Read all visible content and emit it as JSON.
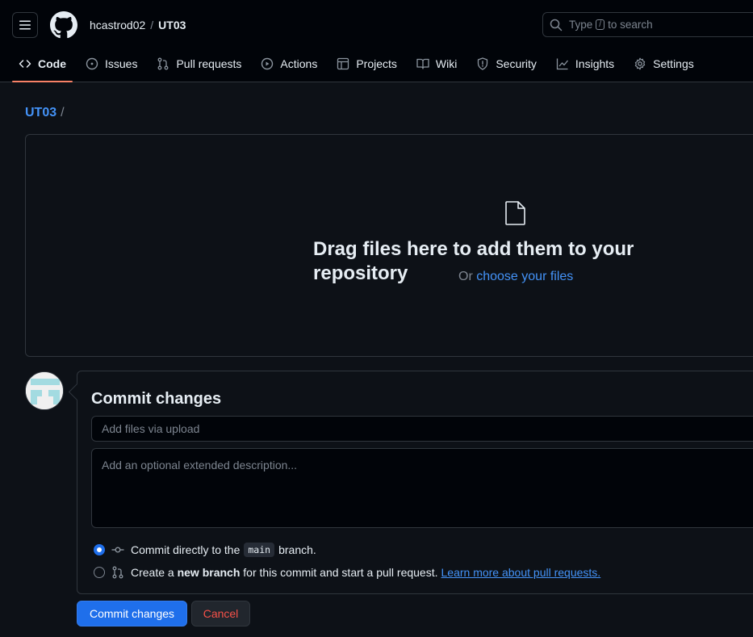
{
  "header": {
    "owner": "hcastrod02",
    "separator": "/",
    "repo": "UT03",
    "search": {
      "prefix": "Type",
      "key": "/",
      "suffix": "to search"
    }
  },
  "tabs": [
    {
      "label": "Code",
      "icon": "code-icon",
      "active": true
    },
    {
      "label": "Issues",
      "icon": "issue-icon"
    },
    {
      "label": "Pull requests",
      "icon": "pull-request-icon"
    },
    {
      "label": "Actions",
      "icon": "play-icon"
    },
    {
      "label": "Projects",
      "icon": "table-icon"
    },
    {
      "label": "Wiki",
      "icon": "book-icon"
    },
    {
      "label": "Security",
      "icon": "shield-icon"
    },
    {
      "label": "Insights",
      "icon": "graph-icon"
    },
    {
      "label": "Settings",
      "icon": "gear-icon"
    }
  ],
  "path": {
    "repo": "UT03",
    "slash": "/"
  },
  "dropzone": {
    "title": "Drag files here to add them to your repository",
    "or": "Or",
    "choose": "choose your files"
  },
  "commit": {
    "title": "Commit changes",
    "summary_placeholder": "Add files via upload",
    "description_placeholder": "Add an optional extended description...",
    "option_direct": {
      "before": "Commit directly to the",
      "branch": "main",
      "after": "branch."
    },
    "option_new": {
      "before": "Create a",
      "bold": "new branch",
      "after": "for this commit and start a pull request.",
      "link": "Learn more about pull requests."
    },
    "submit_label": "Commit changes",
    "cancel_label": "Cancel"
  },
  "colors": {
    "accent": "#1f6feb",
    "link": "#4493f8",
    "danger": "#f85149",
    "active_tab_underline": "#f78166"
  }
}
